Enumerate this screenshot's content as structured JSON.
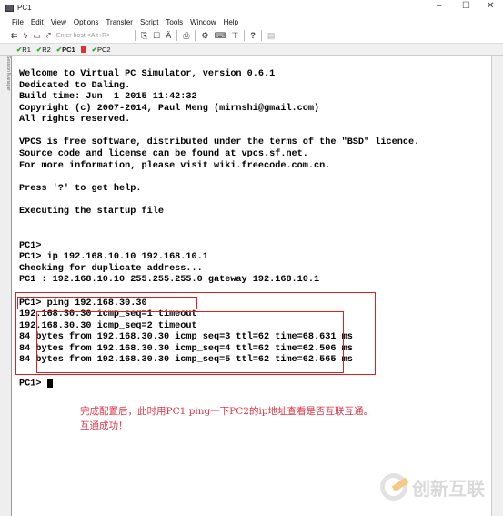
{
  "window": {
    "title": "PC1",
    "minimize": "–",
    "maximize": "☐",
    "close": "✕"
  },
  "menu": [
    "File",
    "Edit",
    "View",
    "Options",
    "Transfer",
    "Script",
    "Tools",
    "Window",
    "Help"
  ],
  "toolbar": {
    "host_placeholder": "Enter host <Alt+R>",
    "icons": [
      "connect-icon",
      "lightning-icon",
      "reconnect-icon",
      "disconnect-icon",
      "copy-icon",
      "paste-icon",
      "find-icon",
      "print-icon",
      "settings-icon",
      "keymap-icon",
      "filter-icon",
      "help-icon",
      "log-icon"
    ]
  },
  "tabs": [
    {
      "label": "R1"
    },
    {
      "label": "R2"
    },
    {
      "label": "PC1",
      "active": true
    },
    {
      "label": "PC2"
    }
  ],
  "sidebar": {
    "label": "Session Manager"
  },
  "terminal": {
    "lines": [
      "Welcome to Virtual PC Simulator, version 0.6.1",
      "Dedicated to Daling.",
      "Build time: Jun  1 2015 11:42:32",
      "Copyright (c) 2007-2014, Paul Meng (mirnshi@gmail.com)",
      "All rights reserved.",
      "",
      "VPCS is free software, distributed under the terms of the \"BSD\" licence.",
      "Source code and license can be found at vpcs.sf.net.",
      "For more information, please visit wiki.freecode.com.cn.",
      "",
      "Press '?' to get help.",
      "",
      "Executing the startup file",
      "",
      "",
      "PC1>",
      "PC1> ip 192.168.10.10 192.168.10.1",
      "Checking for duplicate address...",
      "PC1 : 192.168.10.10 255.255.255.0 gateway 192.168.10.1",
      "",
      "PC1> ping 192.168.30.30",
      "192.168.30.30 icmp_seq=1 timeout",
      "192.168.30.30 icmp_seq=2 timeout",
      "84 bytes from 192.168.30.30 icmp_seq=3 ttl=62 time=68.631 ms",
      "84 bytes from 192.168.30.30 icmp_seq=4 ttl=62 time=62.506 ms",
      "84 bytes from 192.168.30.30 icmp_seq=5 ttl=62 time=62.565 ms",
      "",
      "PC1> "
    ]
  },
  "annotation": {
    "line1": "完成配置后，此时用PC1 ping一下PC2的ip地址查看是否互联互通。",
    "line2": "互通成功！",
    "color": "#e0364a",
    "box_color": "#e02020"
  },
  "watermark": {
    "text": "创新互联"
  }
}
